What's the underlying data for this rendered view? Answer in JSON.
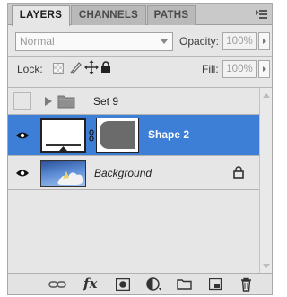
{
  "tabs": [
    {
      "label": "LAYERS",
      "active": true
    },
    {
      "label": "CHANNELS",
      "active": false
    },
    {
      "label": "PATHS",
      "active": false
    }
  ],
  "blend": {
    "value": "Normal"
  },
  "opacity": {
    "label": "Opacity:",
    "value": "100%"
  },
  "lock": {
    "label": "Lock:"
  },
  "fill": {
    "label": "Fill:",
    "value": "100%"
  },
  "layers": [
    {
      "name": "Set 9",
      "type": "group",
      "visible": false,
      "selected": false
    },
    {
      "name": "Shape 2",
      "type": "shape",
      "visible": true,
      "selected": true
    },
    {
      "name": "Background",
      "type": "image",
      "visible": true,
      "selected": false,
      "locked": true
    }
  ],
  "colors": {
    "selection": "#3d7fd6",
    "panel": "#e6e6e6",
    "tabbar": "#c9c9c9"
  },
  "bottom_icons": [
    "link-layers-icon",
    "fx-icon",
    "add-mask-icon",
    "adjustment-layer-icon",
    "new-group-icon",
    "new-layer-icon",
    "delete-layer-icon"
  ],
  "bottom": {
    "fx": "fx"
  }
}
